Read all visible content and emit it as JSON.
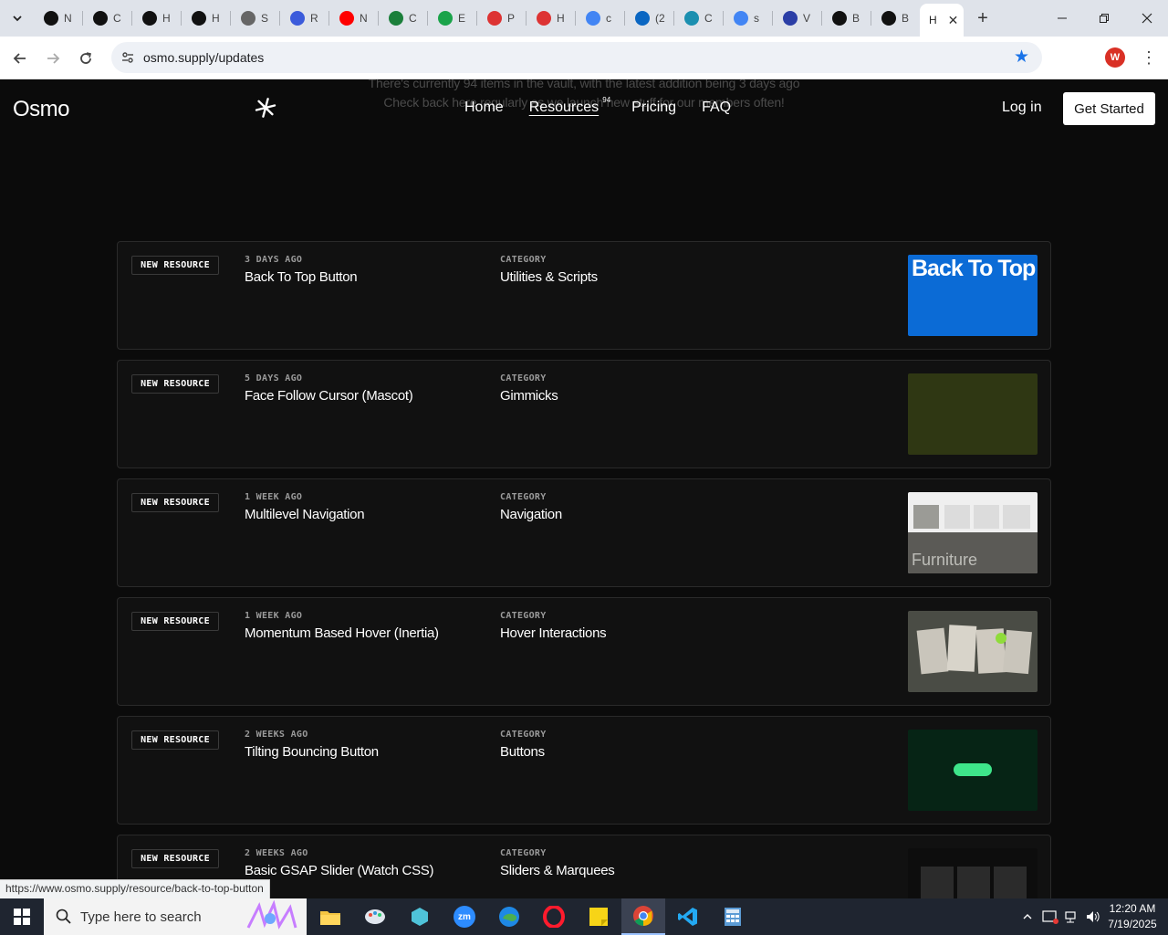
{
  "browser": {
    "tabs": [
      {
        "letter": "N",
        "icon": "openai-icon",
        "color": "#111111"
      },
      {
        "letter": "C",
        "icon": "openai-icon",
        "color": "#111111"
      },
      {
        "letter": "H",
        "icon": "openai-icon",
        "color": "#111111"
      },
      {
        "letter": "H",
        "icon": "openai-icon",
        "color": "#111111"
      },
      {
        "letter": "S",
        "icon": "wordpress-icon",
        "color": "#666666"
      },
      {
        "letter": "R",
        "icon": "rocket-icon",
        "color": "#3b5bdb"
      },
      {
        "letter": "N",
        "icon": "youtube-icon",
        "color": "#ff0000"
      },
      {
        "letter": "C",
        "icon": "w-icon",
        "color": "#1b7f3b"
      },
      {
        "letter": "E",
        "icon": "lightning-icon",
        "color": "#1aa34a"
      },
      {
        "letter": "P",
        "icon": "tag-icon",
        "color": "#d33"
      },
      {
        "letter": "H",
        "icon": "tag-icon",
        "color": "#d33"
      },
      {
        "letter": "c",
        "icon": "google-icon",
        "color": "#4285f4"
      },
      {
        "letter": "(2",
        "icon": "linkedin-icon",
        "color": "#0a66c2"
      },
      {
        "letter": "C",
        "icon": "hexagon-icon",
        "color": "#1b8fb0"
      },
      {
        "letter": "s",
        "icon": "google-icon",
        "color": "#4285f4"
      },
      {
        "letter": "V",
        "icon": "x-shape-icon",
        "color": "#2b3ea6"
      },
      {
        "letter": "B",
        "icon": "x-logo-icon",
        "color": "#111111"
      },
      {
        "letter": "B",
        "icon": "x-logo-icon",
        "color": "#111111"
      }
    ],
    "active_tab_letter": "H",
    "url": "osmo.supply/updates",
    "status_url": "https://www.osmo.supply/resource/back-to-top-button",
    "profile_initial": "W"
  },
  "site": {
    "logo": "Osmo",
    "ghost_line_1": "There's currently 94 items in the vault, with the latest addition being 3 days ago",
    "ghost_line_2": "Check back here regularly as we launch new stuff for our members often!",
    "nav": {
      "home": "Home",
      "resources": "Resources",
      "resources_count": "94",
      "pricing": "Pricing",
      "faq": "FAQ",
      "login": "Log in",
      "cta": "Get Started"
    }
  },
  "resources": [
    {
      "badge": "NEW RESOURCE",
      "age": "3 DAYS AGO",
      "title": "Back To Top Button",
      "category_label": "CATEGORY",
      "category": "Utilities & Scripts",
      "thumb_text": "Back To Top"
    },
    {
      "badge": "NEW RESOURCE",
      "age": "5 DAYS AGO",
      "title": "Face Follow Cursor (Mascot)",
      "category_label": "CATEGORY",
      "category": "Gimmicks",
      "thumb_text": ""
    },
    {
      "badge": "NEW RESOURCE",
      "age": "1 WEEK AGO",
      "title": "Multilevel Navigation",
      "category_label": "CATEGORY",
      "category": "Navigation",
      "thumb_text": "Furniture"
    },
    {
      "badge": "NEW RESOURCE",
      "age": "1 WEEK AGO",
      "title": "Momentum Based Hover (Inertia)",
      "category_label": "CATEGORY",
      "category": "Hover Interactions",
      "thumb_text": ""
    },
    {
      "badge": "NEW RESOURCE",
      "age": "2 WEEKS AGO",
      "title": "Tilting Bouncing Button",
      "category_label": "CATEGORY",
      "category": "Buttons",
      "thumb_text": ""
    },
    {
      "badge": "NEW RESOURCE",
      "age": "2 WEEKS AGO",
      "title": "Basic GSAP Slider (Watch CSS)",
      "category_label": "CATEGORY",
      "category": "Sliders & Marquees",
      "thumb_text": ""
    }
  ],
  "taskbar": {
    "search_placeholder": "Type here to search",
    "time": "12:20 AM",
    "date": "7/19/2025"
  }
}
